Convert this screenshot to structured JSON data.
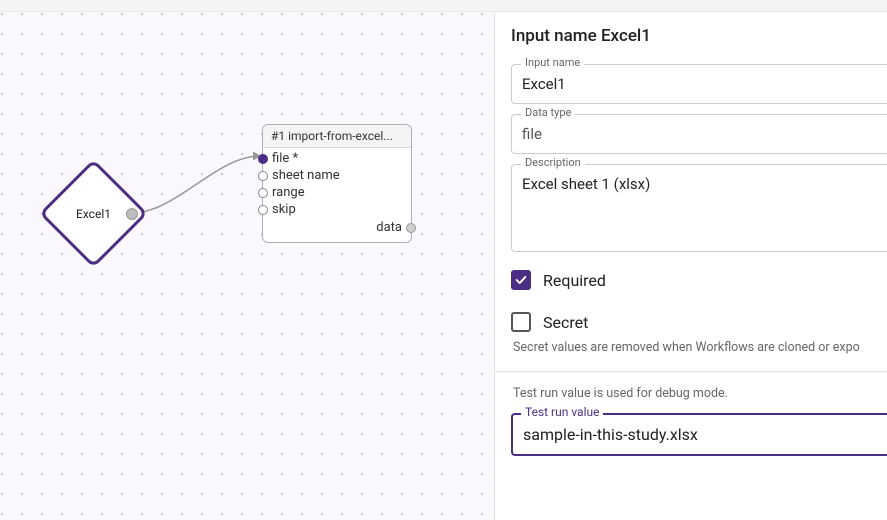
{
  "canvas": {
    "input_node": {
      "label": "Excel1"
    },
    "card_node": {
      "header": "#1 import-from-excel...",
      "ports_in": [
        {
          "label": "file *",
          "connected": true
        },
        {
          "label": "sheet name",
          "connected": false
        },
        {
          "label": "range",
          "connected": false
        },
        {
          "label": "skip",
          "connected": false
        }
      ],
      "ports_out": [
        {
          "label": "data"
        }
      ]
    }
  },
  "panel": {
    "title_prefix": "Input name",
    "title_value": "Excel1",
    "fields": {
      "input_name": {
        "legend": "Input name",
        "value": "Excel1"
      },
      "data_type": {
        "legend": "Data type",
        "value": "file"
      },
      "description": {
        "legend": "Description",
        "value": "Excel sheet 1 (xlsx)"
      }
    },
    "required": {
      "label": "Required",
      "checked": true
    },
    "secret": {
      "label": "Secret",
      "checked": false,
      "help": "Secret values are removed when Workflows are cloned or expo"
    },
    "test_run": {
      "help": "Test run value is used for debug mode.",
      "legend": "Test run value",
      "value": "sample-in-this-study.xlsx"
    }
  }
}
